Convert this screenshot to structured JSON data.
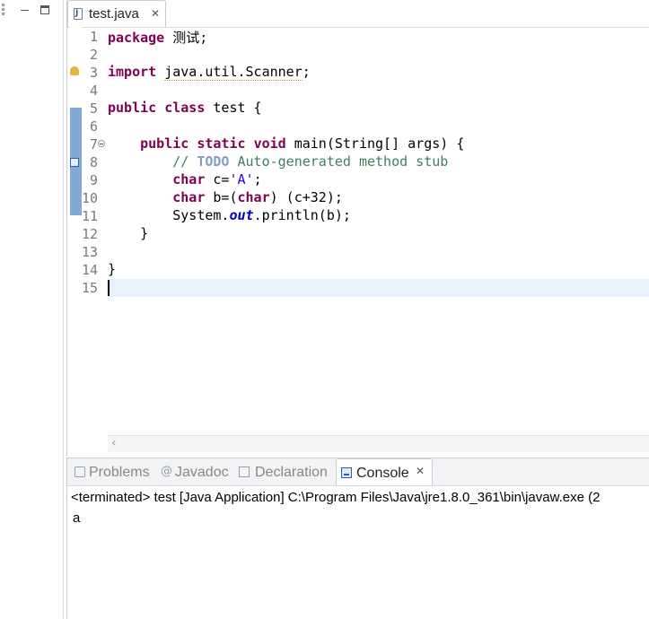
{
  "editor": {
    "tab": {
      "label": "test.java",
      "close": "✕"
    },
    "line_numbers": [
      "1",
      "2",
      "3",
      "4",
      "5",
      "6",
      "7",
      "8",
      "9",
      "10",
      "11",
      "12",
      "13",
      "14",
      "15"
    ],
    "code": {
      "l1_kw": "package",
      "l1_rest": " 测试;",
      "l3_kw": "import",
      "l3_rest": "java.util.Scanner",
      "l3_end": ";",
      "l5_kw1": "public",
      "l5_kw2": "class",
      "l5_rest": " test {",
      "l7_kw1": "public",
      "l7_kw2": "static",
      "l7_kw3": "void",
      "l7_rest": " main(String[] args) {",
      "l8_cm1": "// ",
      "l8_todo": "TODO",
      "l8_cm2": " Auto-generated method stub",
      "l9_kw": "char",
      "l9_a": " c=",
      "l9_str": "'A'",
      "l9_b": ";",
      "l10_kw1": "char",
      "l10_a": " b=(",
      "l10_kw2": "char",
      "l10_b": ") (c+32);",
      "l11_a": "System.",
      "l11_fld": "out",
      "l11_b": ".println(b);",
      "l12": "}",
      "l14": "}"
    }
  },
  "bottom": {
    "tabs": [
      {
        "label": "Problems"
      },
      {
        "label": "Javadoc"
      },
      {
        "label": "Declaration"
      },
      {
        "label": "Console"
      }
    ],
    "close": "✕",
    "terminated": "<terminated> test [Java Application] C:\\Program Files\\Java\\jre1.8.0_361\\bin\\javaw.exe  (2",
    "output": "a"
  }
}
